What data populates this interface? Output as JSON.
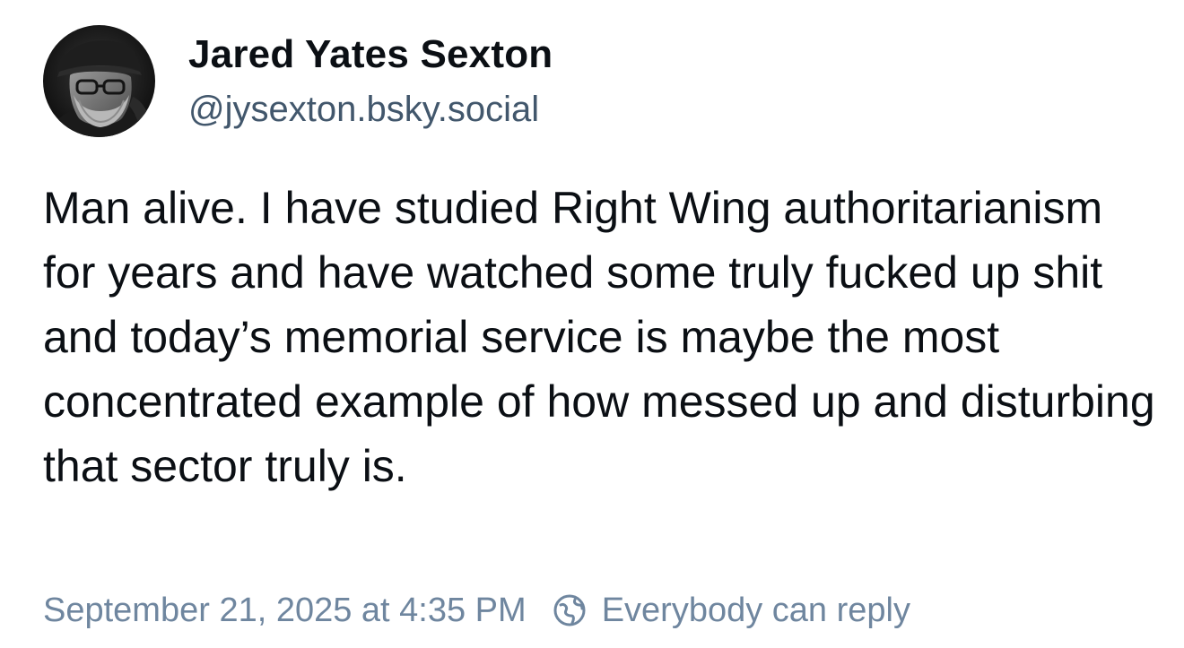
{
  "author": {
    "display_name": "Jared Yates Sexton",
    "handle": "@jysexton.bsky.social",
    "avatar_icon": "profile-photo-avatar"
  },
  "post": {
    "text": "Man alive. I have studied Right Wing authoritarianism for years and have watched some truly fucked up shit and today’s memorial service is maybe the most concentrated example of how messed up and disturbing that sector truly is."
  },
  "meta": {
    "timestamp": "September 21, 2025 at 4:35 PM",
    "reply_icon": "globe-icon",
    "reply_setting": "Everybody can reply"
  },
  "colors": {
    "text_primary": "#0b0f14",
    "text_handle": "#42576c",
    "text_meta": "#6f869f",
    "background": "#ffffff"
  }
}
